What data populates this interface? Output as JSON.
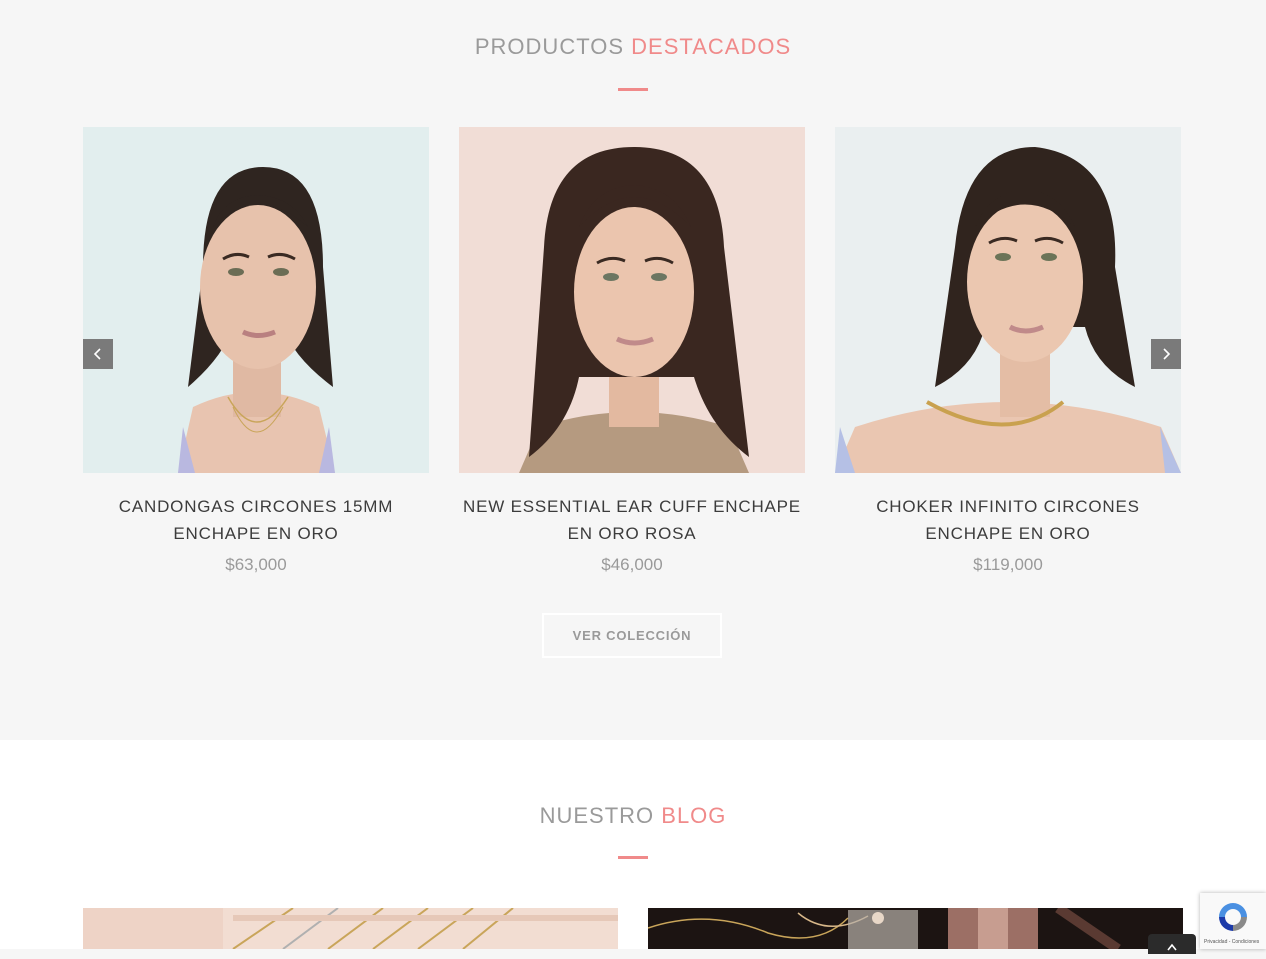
{
  "featured": {
    "title_plain": "PRODUCTOS",
    "title_accent": "DESTACADOS",
    "products": [
      {
        "name": "CANDONGAS CIRCONES 15MM ENCHAPE EN ORO",
        "price": "$63,000"
      },
      {
        "name": "NEW ESSENTIAL EAR CUFF ENCHAPE EN ORO ROSA",
        "price": "$46,000"
      },
      {
        "name": "CHOKER INFINITO CIRCONES ENCHAPE EN ORO",
        "price": "$119,000"
      }
    ],
    "button_label": "VER COLECCIÓN"
  },
  "blog": {
    "title_plain": "NUESTRO",
    "title_accent": "BLOG"
  },
  "recaptcha": {
    "label": "Privacidad - Condiciones"
  },
  "colors": {
    "accent": "#f08a8a",
    "muted_text": "#9a9a9a",
    "dark_text": "#3c3c3c",
    "section_bg": "#f6f6f6"
  },
  "icons": [
    "chevron-left-icon",
    "chevron-right-icon",
    "recaptcha-icon",
    "chevron-up-icon"
  ]
}
